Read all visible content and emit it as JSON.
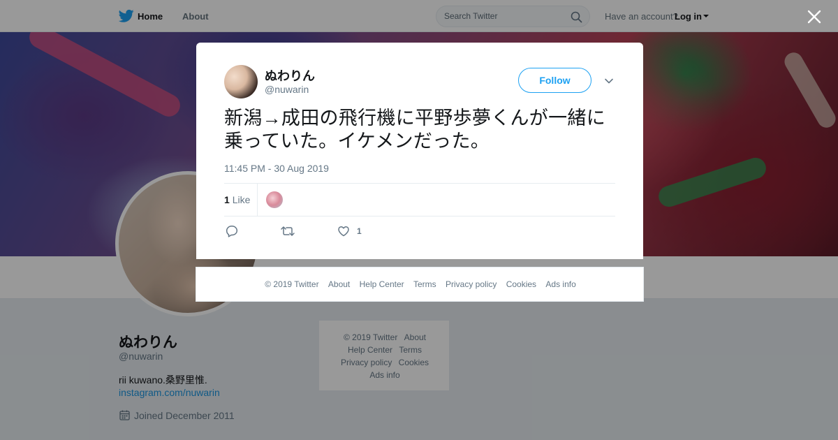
{
  "nav": {
    "home_label": "Home",
    "about_label": "About",
    "search_placeholder": "Search Twitter",
    "have_account": "Have an account?",
    "login_label": "Log in"
  },
  "profile": {
    "name": "ぬわりん",
    "handle": "@nuwarin",
    "bio": "rii kuwano.桑野里惟.",
    "link": "instagram.com/nuwarin",
    "joined": "Joined December 2011"
  },
  "side_footer": {
    "line1": [
      "© 2019 Twitter",
      "About"
    ],
    "line2": [
      "Help Center",
      "Terms"
    ],
    "line3": [
      "Privacy policy",
      "Cookies"
    ],
    "line4": [
      "Ads info"
    ]
  },
  "tweet": {
    "author_name": "ぬわりん",
    "author_handle": "@nuwarin",
    "follow_label": "Follow",
    "text": "新潟→成田の飛行機に平野歩夢くんが一緒に乗っていた。イケメンだった。",
    "timestamp": "11:45 PM - 30 Aug 2019",
    "like_count": "1",
    "like_label": "Like",
    "action_like_count": "1"
  },
  "modal_footer": {
    "links": [
      "© 2019 Twitter",
      "About",
      "Help Center",
      "Terms",
      "Privacy policy",
      "Cookies",
      "Ads info"
    ]
  },
  "colors": {
    "accent": "#1da1f2",
    "link": "#1b95e0",
    "secondary_text": "#657786"
  },
  "icons": {
    "nav_logo": "twitter-bird-icon",
    "search": "search-icon",
    "close": "close-icon",
    "more": "chevron-down-icon",
    "reply": "reply-icon",
    "retweet": "retweet-icon",
    "like": "heart-icon",
    "joined": "calendar-icon"
  }
}
